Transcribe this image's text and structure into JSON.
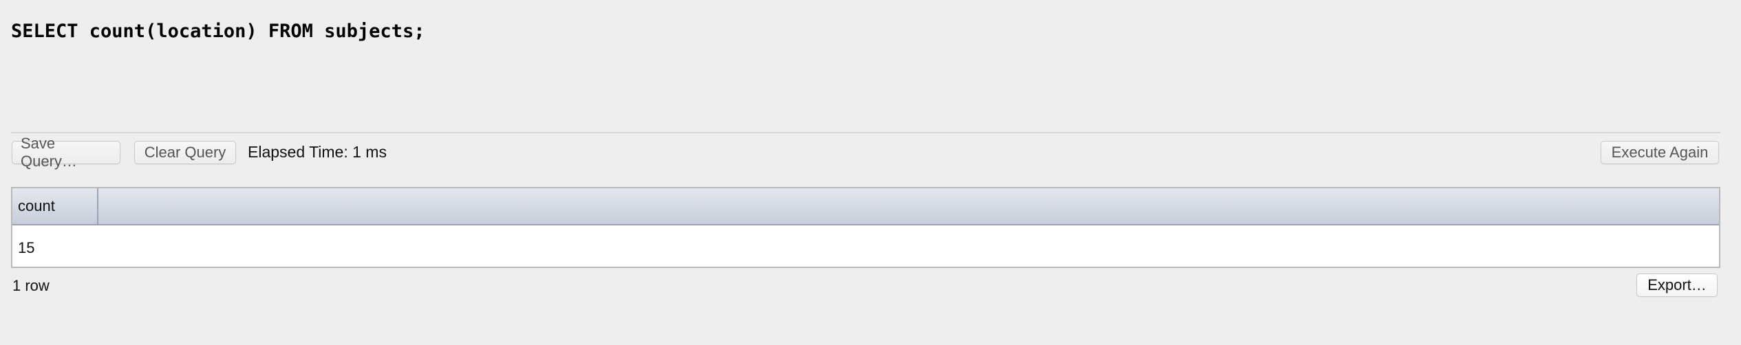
{
  "editor": {
    "query": "SELECT count(location) FROM subjects;"
  },
  "toolbar": {
    "save_label": "Save Query…",
    "clear_label": "Clear Query",
    "elapsed_text": "Elapsed Time: 1 ms",
    "execute_label": "Execute Again"
  },
  "results": {
    "columns": [
      "count"
    ],
    "rows": [
      [
        "15"
      ]
    ],
    "row_count_text": "1 row"
  },
  "footer": {
    "export_label": "Export…"
  }
}
